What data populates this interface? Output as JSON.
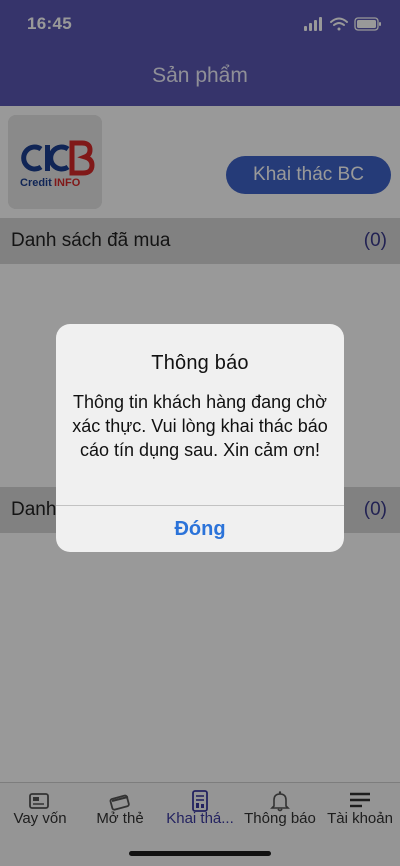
{
  "status_bar": {
    "time": "16:45"
  },
  "header": {
    "title": "Sản phẩm"
  },
  "logo": {
    "brand_text": "CIC",
    "brand_letter": "B",
    "sub_text_a": "Credit",
    "sub_text_b": "INFO"
  },
  "actions": {
    "khai_thac_label": "Khai thác BC"
  },
  "sections": [
    {
      "label": "Danh sách đã mua",
      "count": "(0)"
    },
    {
      "label": "Danh",
      "count": "(0)"
    }
  ],
  "tabbar": {
    "items": [
      {
        "label": "Vay vốn",
        "icon": "loan-card-icon"
      },
      {
        "label": "Mở thẻ",
        "icon": "credit-card-icon"
      },
      {
        "label": "Khai thá...",
        "icon": "report-icon",
        "active": true
      },
      {
        "label": "Thông báo",
        "icon": "bell-icon"
      },
      {
        "label": "Tài khoản",
        "icon": "menu-lines-icon"
      }
    ]
  },
  "alert": {
    "title": "Thông báo",
    "message": "Thông tin khách hàng đang chờ xác thực. Vui lòng khai thác báo cáo tín dụng sau. Xin cảm ơn!",
    "button": "Đóng"
  },
  "colors": {
    "header": "#5a57b2",
    "button": "#3e63c8",
    "accent_link": "#2b73d9"
  }
}
